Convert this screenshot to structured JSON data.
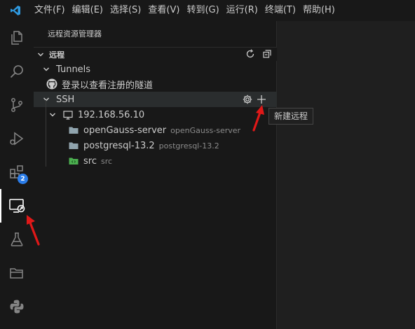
{
  "menu": {
    "items": [
      "文件(F)",
      "编辑(E)",
      "选择(S)",
      "查看(V)",
      "转到(G)",
      "运行(R)",
      "终端(T)",
      "帮助(H)"
    ]
  },
  "activity_bar": {
    "icons": [
      "explorer-icon",
      "search-icon",
      "source-control-icon",
      "run-debug-icon",
      "extensions-icon",
      "remote-explorer-icon",
      "testing-icon",
      "folder-icon",
      "python-icon"
    ],
    "extensions_badge": "2"
  },
  "sidebar": {
    "title": "远程资源管理器",
    "section_label": "远程",
    "tunnels": {
      "label": "Tunnels",
      "sign_in": "登录以查看注册的隧道"
    },
    "ssh": {
      "label": "SSH",
      "host": "192.168.56.10",
      "folders": [
        {
          "name": "openGauss-server",
          "desc": "openGauss-server"
        },
        {
          "name": "postgresql-13.2",
          "desc": "postgresql-13.2"
        },
        {
          "name": "src",
          "desc": "src"
        }
      ]
    }
  },
  "tooltip": {
    "text": "新建远程"
  },
  "colors": {
    "accent": "#2b7de9",
    "annotation_arrow": "#e01818",
    "logo": "#2f9ae0",
    "src_folder": "#4caf50"
  }
}
